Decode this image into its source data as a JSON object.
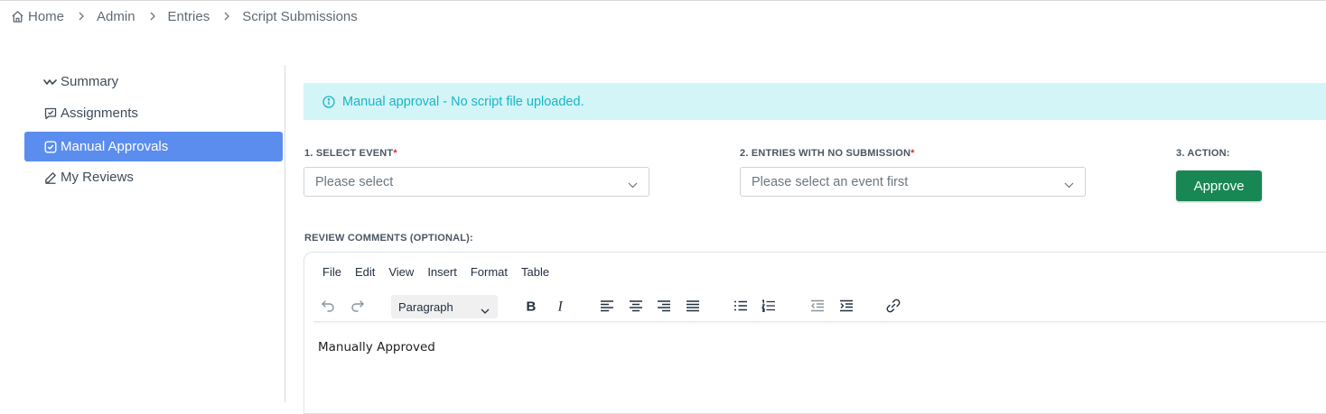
{
  "breadcrumb": {
    "items": [
      "Home",
      "Admin",
      "Entries",
      "Script Submissions"
    ],
    "icons": {
      "home": "home-icon",
      "separator": "chevron-right-icon"
    }
  },
  "sidebar": {
    "items": [
      {
        "label": "Summary",
        "icon": "activity-icon",
        "active": false
      },
      {
        "label": "Assignments",
        "icon": "message-square-check-icon",
        "active": false
      },
      {
        "label": "Manual Approvals",
        "icon": "check-square-icon",
        "active": true
      },
      {
        "label": "My Reviews",
        "icon": "pencil-icon",
        "active": false
      }
    ]
  },
  "alert": {
    "text": "Manual approval - No script file uploaded.",
    "icon": "info-icon",
    "color": "#17b6c8",
    "background": "#d3f5f7"
  },
  "form": {
    "event": {
      "label": "1. SELECT EVENT",
      "required": "*",
      "value": "Please select"
    },
    "entries": {
      "label": "2. ENTRIES WITH NO SUBMISSION",
      "required": "*",
      "value": "Please select an event first"
    },
    "action": {
      "label": "3. ACTION:",
      "button": "Approve",
      "button_color": "#198754"
    },
    "comments_label": "REVIEW COMMENTS (OPTIONAL):"
  },
  "editor": {
    "menu": [
      "File",
      "Edit",
      "View",
      "Insert",
      "Format",
      "Table"
    ],
    "format_select": "Paragraph",
    "toolbar_icons": [
      "undo-icon",
      "redo-icon",
      "bold-icon",
      "italic-icon",
      "align-left-icon",
      "align-center-icon",
      "align-right-icon",
      "align-justify-icon",
      "bullet-list-icon",
      "numbered-list-icon",
      "outdent-icon",
      "indent-icon",
      "link-icon"
    ],
    "content": "Manually Approved"
  },
  "colors": {
    "accent": "#5b8def",
    "success": "#198754",
    "required": "#d32f2f"
  }
}
